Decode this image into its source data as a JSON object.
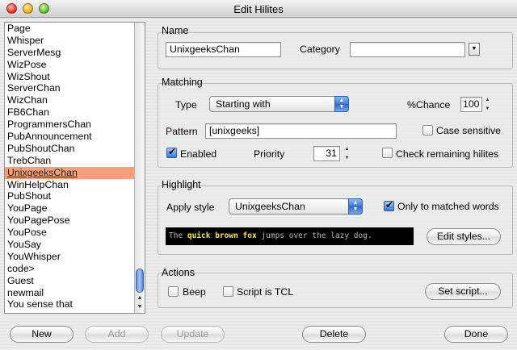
{
  "window": {
    "title": "Edit Hilites"
  },
  "hilites_list": {
    "items": [
      "Page",
      "Whisper",
      "ServerMesg",
      "WizPose",
      "WizShout",
      "ServerChan",
      "WizChan",
      "FB6Chan",
      "ProgrammersChan",
      "PubAnnouncement",
      "PubShoutChan",
      "TrebChan",
      "UnixgeeksChan",
      "WinHelpChan",
      "PubShout",
      "YouPage",
      "YouPagePose",
      "YouPose",
      "YouSay",
      "YouWhisper",
      "code>",
      "Guest",
      "newmail",
      "You sense that"
    ],
    "selected": "UnixgeeksChan"
  },
  "name_group": {
    "label": "Name",
    "name_value": "UnixgeeksChan",
    "category_label": "Category",
    "category_value": ""
  },
  "matching_group": {
    "label": "Matching",
    "type_label": "Type",
    "type_value": "Starting with",
    "chance_label": "%Chance",
    "chance_value": "100",
    "pattern_label": "Pattern",
    "pattern_value": "[unixgeeks]",
    "case_sensitive_label": "Case sensitive",
    "enabled_label": "Enabled",
    "priority_label": "Priority",
    "priority_value": "31",
    "check_remaining_label": "Check remaining hilites"
  },
  "highlight_group": {
    "label": "Highlight",
    "apply_style_label": "Apply style",
    "apply_style_value": "UnixgeeksChan",
    "only_matched_label": "Only to matched words",
    "preview_before": "The ",
    "preview_highlight": "quick brown fox",
    "preview_after": " jumps over the lazy dog.",
    "edit_styles_label": "Edit styles..."
  },
  "actions_group": {
    "label": "Actions",
    "beep_label": "Beep",
    "script_tcl_label": "Script is TCL",
    "set_script_label": "Set script..."
  },
  "buttons": {
    "new": "New",
    "add": "Add",
    "update": "Update",
    "delete": "Delete",
    "done": "Done"
  },
  "colors": {
    "selection": "#f5a07a",
    "preview_bg": "#000000",
    "preview_highlight": "#f7e35a",
    "accent": "#3d79d6"
  },
  "checkboxes": {
    "case_sensitive": false,
    "enabled": true,
    "check_remaining": false,
    "only_matched": true,
    "beep": false,
    "script_tcl": false
  }
}
